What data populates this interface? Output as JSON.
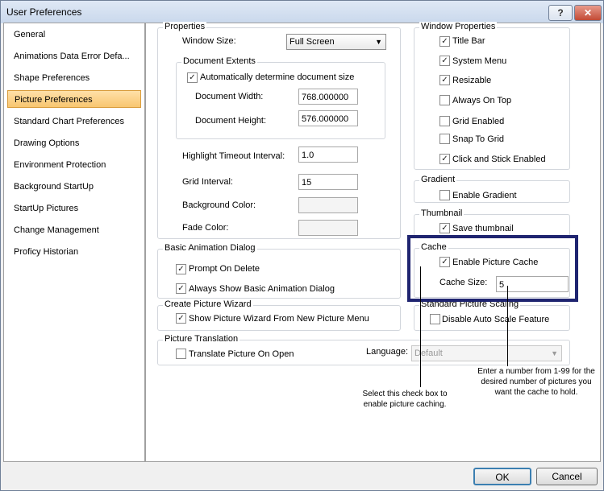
{
  "window": {
    "title": "User Preferences",
    "help_label": "?",
    "close_label": "✕"
  },
  "sidebar": {
    "items": [
      {
        "label": "General"
      },
      {
        "label": "Animations Data Error Defa..."
      },
      {
        "label": "Shape Preferences"
      },
      {
        "label": "Picture Preferences",
        "active": true
      },
      {
        "label": "Standard Chart Preferences"
      },
      {
        "label": "Drawing Options"
      },
      {
        "label": "Environment Protection"
      },
      {
        "label": "Background StartUp"
      },
      {
        "label": "StartUp Pictures"
      },
      {
        "label": "Change Management"
      },
      {
        "label": "Proficy Historian"
      }
    ]
  },
  "properties": {
    "label": "Properties",
    "window_size_label": "Window Size:",
    "window_size_value": "Full Screen",
    "doc_extents_label": "Document Extents",
    "auto_size_label": "Automatically determine document size",
    "auto_size_checked": true,
    "doc_width_label": "Document Width:",
    "doc_width_value": "768.000000",
    "doc_height_label": "Document Height:",
    "doc_height_value": "576.000000",
    "highlight_label": "Highlight Timeout Interval:",
    "highlight_value": "1.0",
    "grid_interval_label": "Grid Interval:",
    "grid_interval_value": "15",
    "bg_color_label": "Background Color:",
    "fade_color_label": "Fade Color:"
  },
  "basic_animation": {
    "label": "Basic Animation Dialog",
    "prompt_delete_label": "Prompt On Delete",
    "always_show_label": "Always Show Basic Animation Dialog"
  },
  "create_wizard": {
    "label": "Create Picture Wizard",
    "show_wizard_label": "Show Picture Wizard From New Picture Menu"
  },
  "translation": {
    "label": "Picture Translation",
    "translate_label": "Translate Picture On Open",
    "language_label": "Language:",
    "language_value": "Default"
  },
  "window_properties": {
    "label": "Window Properties",
    "items": [
      {
        "label": "Title Bar",
        "checked": true
      },
      {
        "label": "System Menu",
        "checked": true
      },
      {
        "label": "Resizable",
        "checked": true
      },
      {
        "label": "Always On Top",
        "checked": false
      },
      {
        "label": "Grid Enabled",
        "checked": false
      },
      {
        "label": "Snap To Grid",
        "checked": false
      },
      {
        "label": "Click and Stick Enabled",
        "checked": true
      }
    ]
  },
  "gradient": {
    "label": "Gradient",
    "enable_label": "Enable Gradient"
  },
  "thumbnail": {
    "label": "Thumbnail",
    "save_label": "Save thumbnail"
  },
  "cache": {
    "label": "Cache",
    "enable_label": "Enable Picture Cache",
    "size_label": "Cache Size:",
    "size_value": "5"
  },
  "scaling": {
    "label": "Standard Picture Scaling",
    "disable_label": "Disable Auto Scale Feature"
  },
  "callouts": {
    "left_text": "Select this check box to enable picture caching.",
    "right_text": "Enter a number from 1-99 for the desired number of pictures you want the cache to hold."
  },
  "footer": {
    "ok_label": "OK",
    "cancel_label": "Cancel"
  },
  "colors": {
    "highlight_border": "#1f2470",
    "active_item": "#f8c670"
  }
}
